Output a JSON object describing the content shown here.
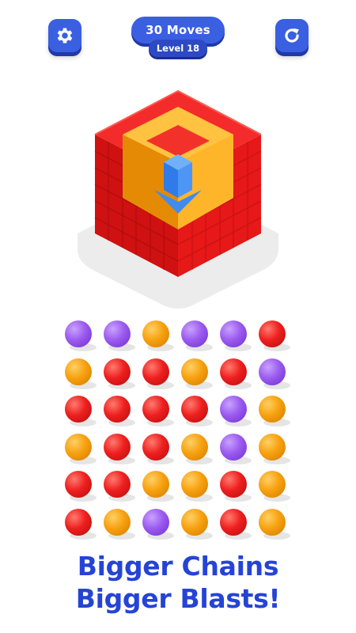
{
  "header": {
    "moves_label": "30 Moves",
    "level_label": "Level 18",
    "settings_icon": "gear-icon",
    "restart_icon": "restart-icon"
  },
  "colors": {
    "purple": "#9b5bef",
    "orange": "#f7a10f",
    "red": "#ee1f1f",
    "blue": "#3a5fe0",
    "text": "#2544d6"
  },
  "board": [
    [
      "purple",
      "purple",
      "orange",
      "purple",
      "purple",
      "red"
    ],
    [
      "orange",
      "red",
      "red",
      "orange",
      "red",
      "purple"
    ],
    [
      "red",
      "red",
      "red",
      "red",
      "purple",
      "orange"
    ],
    [
      "orange",
      "red",
      "red",
      "orange",
      "purple",
      "orange"
    ],
    [
      "red",
      "red",
      "orange",
      "orange",
      "red",
      "orange"
    ],
    [
      "red",
      "orange",
      "purple",
      "orange",
      "red",
      "orange"
    ]
  ],
  "slogan": {
    "line1": "Bigger Chains",
    "line2": "Bigger Blasts!"
  }
}
